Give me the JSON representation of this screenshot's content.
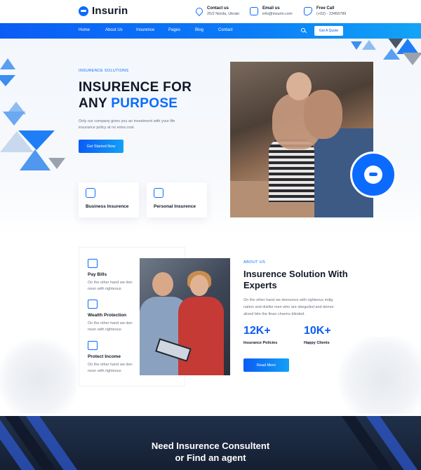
{
  "brand": {
    "name": "Insurin",
    "accent": "#0b6bff"
  },
  "header": {
    "contact": {
      "title": "Contact us",
      "value": "25/2 Norda, Ukrain"
    },
    "email": {
      "title": "Email us",
      "value": "info@insurin.com"
    },
    "call": {
      "title": "Free Call",
      "value": "(+02) - 23456789"
    }
  },
  "nav": {
    "items": [
      "Home",
      "About Us",
      "Insurence",
      "Pages",
      "Blog",
      "Contact"
    ],
    "quote_label": "Get A Quote"
  },
  "hero": {
    "eyebrow": "INSURENCE SOLUTIONS",
    "title_line1": "INSURENCE FOR",
    "title_line2_prefix": "ANY ",
    "title_line2_accent": "PURPOSE",
    "description": "Only our company gives you an investment with your life insurance policy at no extra cost.",
    "cta_label": "Get Started Now",
    "cards": [
      {
        "label": "Business Insurence",
        "icon": "business-icon"
      },
      {
        "label": "Personal Insurence",
        "icon": "personal-icon"
      }
    ]
  },
  "about": {
    "features": [
      {
        "name": "Pay Bills",
        "desc": "On the other hand we den noun with righteous",
        "icon": "bills-icon"
      },
      {
        "name": "Wealth Protection",
        "desc": "On the other hand we den noun with righteous",
        "icon": "wealth-icon"
      },
      {
        "name": "Protect Income",
        "desc": "On the other hand we den noun with righteous",
        "icon": "income-icon"
      }
    ],
    "eyebrow": "ABOUT US",
    "title": "Insurence Solution With Experts",
    "description": "On the other hand we denounce with righteous indig nation and dislike men who are sbeguiled and demor alized bite the finan charms blinded.",
    "stats": [
      {
        "value": "12K+",
        "label": "Insurance Policies"
      },
      {
        "value": "10K+",
        "label": "Happy Clients"
      }
    ],
    "cta_label": "Read More"
  },
  "banner": {
    "line1": "Need Insurence Consultent",
    "line2": "or Find an agent"
  }
}
